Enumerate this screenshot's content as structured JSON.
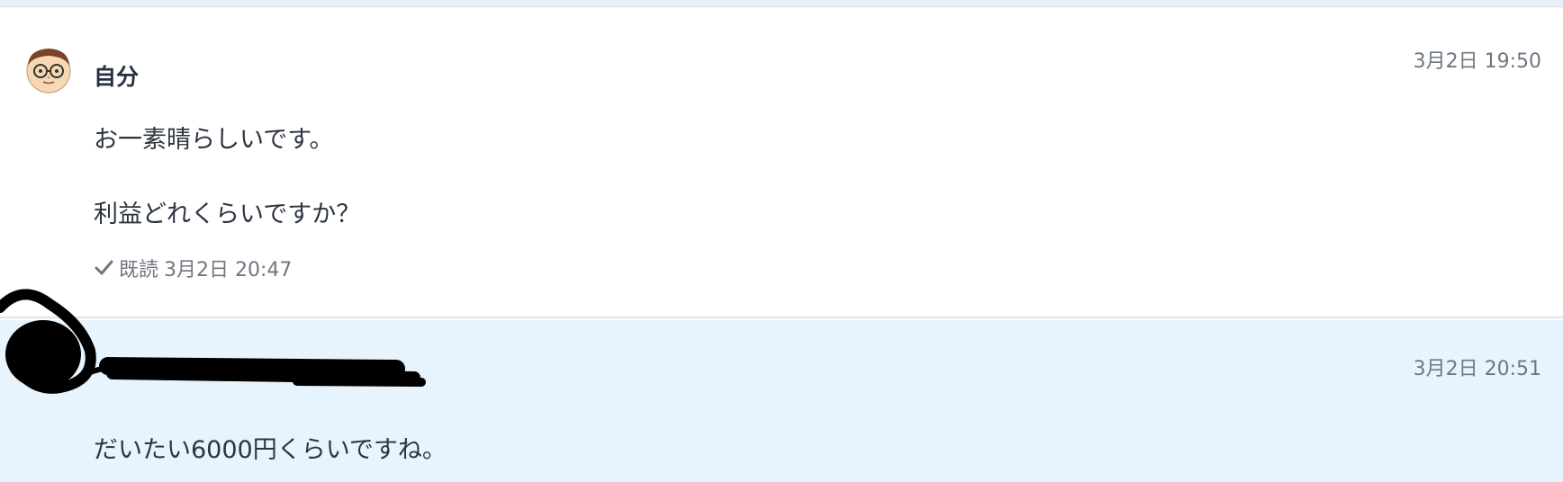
{
  "messages": [
    {
      "sender": "自分",
      "timestamp": "3月2日 19:50",
      "lines": [
        "お一素晴らしいです。",
        "利益どれくらいですか？"
      ],
      "read_label": "既読",
      "read_timestamp": "3月2日 20:47"
    },
    {
      "sender": "",
      "timestamp": "3月2日 20:51",
      "lines": [
        "だいたい6000円くらいですね。"
      ]
    }
  ],
  "colors": {
    "own_bg": "#ffffff",
    "other_bg": "#e7f3fd",
    "text": "#2c3440",
    "meta": "#6f7780",
    "link": "#2d7fd2"
  },
  "icons": {
    "avatar": "glasses-man-avatar-icon",
    "read": "checkmark-icon"
  }
}
